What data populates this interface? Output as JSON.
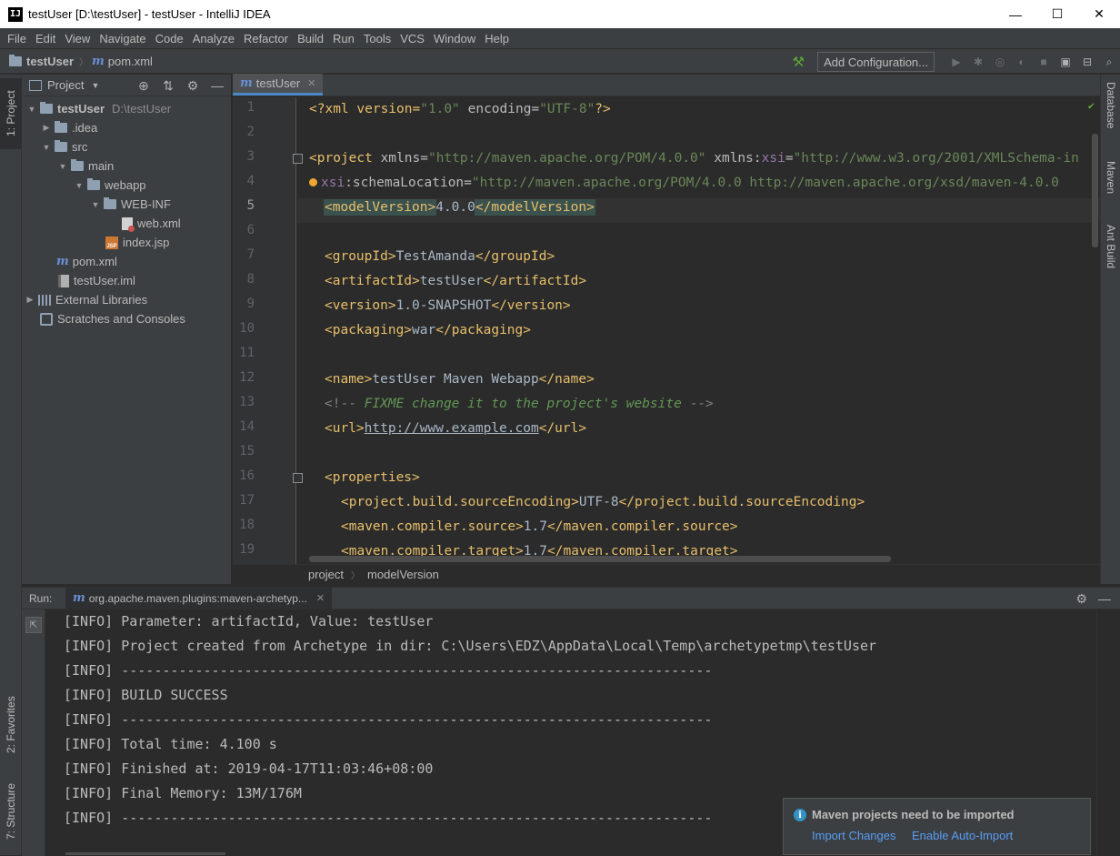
{
  "window": {
    "title": "testUser [D:\\testUser] - testUser - IntelliJ IDEA",
    "app_icon": "IJ",
    "minimize": "—",
    "maximize": "☐",
    "close": "✕"
  },
  "menu": [
    "File",
    "Edit",
    "View",
    "Navigate",
    "Code",
    "Analyze",
    "Refactor",
    "Build",
    "Run",
    "Tools",
    "VCS",
    "Window",
    "Help"
  ],
  "nav": {
    "project": "testUser",
    "file": "pom.xml",
    "add_config": "Add Configuration..."
  },
  "left_tabs": {
    "project": "1: Project",
    "favorites": "2: Favorites",
    "structure": "7: Structure"
  },
  "right_tabs": {
    "database": "Database",
    "maven": "Maven",
    "ant": "Ant Build"
  },
  "project_panel": {
    "title": "Project",
    "tree": [
      {
        "label": "testUser",
        "sub": "D:\\testUser"
      },
      {
        "label": ".idea"
      },
      {
        "label": "src"
      },
      {
        "label": "main"
      },
      {
        "label": "webapp"
      },
      {
        "label": "WEB-INF"
      },
      {
        "label": "web.xml"
      },
      {
        "label": "index.jsp"
      },
      {
        "label": "pom.xml"
      },
      {
        "label": "testUser.iml"
      },
      {
        "label": "External Libraries"
      },
      {
        "label": "Scratches and Consoles"
      }
    ]
  },
  "editor": {
    "tab": "testUser",
    "line_numbers": [
      "1",
      "2",
      "3",
      "4",
      "5",
      "6",
      "7",
      "8",
      "9",
      "10",
      "11",
      "12",
      "13",
      "14",
      "15",
      "16",
      "17",
      "18",
      "19"
    ],
    "breadcrumb": [
      "project",
      "modelVersion"
    ]
  },
  "code": {
    "l1": [
      "<?xml version=",
      "\"1.0\"",
      " encoding=",
      "\"UTF-8\"",
      "?>"
    ],
    "l3": [
      "<project ",
      "xmlns",
      "=",
      "\"http://maven.apache.org/POM/4.0.0\"",
      " xmlns:",
      "xsi",
      "=",
      "\"http://www.w3.org/2001/XMLSchema-in"
    ],
    "l4": [
      "xsi",
      ":schemaLocation",
      "=",
      "\"http://maven.apache.org/POM/4.0.0 http://maven.apache.org/xsd/maven-4.0.0"
    ],
    "l5": [
      "<modelVersion>",
      "4.0.0",
      "</modelVersion>"
    ],
    "l7": [
      "<groupId>",
      "TestAmanda",
      "</groupId>"
    ],
    "l8": [
      "<artifactId>",
      "testUser",
      "</artifactId>"
    ],
    "l9": [
      "<version>",
      "1.0-SNAPSHOT",
      "</version>"
    ],
    "l10": [
      "<packaging>",
      "war",
      "</packaging>"
    ],
    "l12": [
      "<name>",
      "testUser Maven Webapp",
      "</name>"
    ],
    "l13": [
      "<!--",
      " FIXME change it to the project's website ",
      "-->"
    ],
    "l14": [
      "<url>",
      "http://www.example.com",
      "</url>"
    ],
    "l16": [
      "<properties>"
    ],
    "l17": [
      "<project.build.sourceEncoding>",
      "UTF-8",
      "</project.build.sourceEncoding>"
    ],
    "l18": [
      "<maven.compiler.source>",
      "1.7",
      "</maven.compiler.source>"
    ],
    "l19": [
      "<maven.compiler.target>",
      "1.7",
      "</maven.compiler.target>"
    ]
  },
  "run": {
    "label": "Run:",
    "tab": "org.apache.maven.plugins:maven-archetyp...",
    "lines": [
      "[INFO] Parameter: artifactId, Value: testUser",
      "[INFO] Project created from Archetype in dir: C:\\Users\\EDZ\\AppData\\Local\\Temp\\archetypetmp\\testUser",
      "[INFO] ------------------------------------------------------------------------",
      "[INFO] BUILD SUCCESS",
      "[INFO] ------------------------------------------------------------------------",
      "[INFO] Total time: 4.100 s",
      "[INFO] Finished at: 2019-04-17T11:03:46+08:00",
      "[INFO] Final Memory: 13M/176M",
      "[INFO] ------------------------------------------------------------------------"
    ]
  },
  "notification": {
    "title": "Maven projects need to be imported",
    "action1": "Import Changes",
    "action2": "Enable Auto-Import"
  },
  "icons": {
    "gear": "⚙",
    "minus": "—",
    "target": "⊕",
    "collapse": "⇅",
    "play": "▶",
    "check": "✔",
    "info": "i"
  },
  "colors": {
    "tag": "#e8bf6a",
    "attr_value": "#6a8759",
    "namespace": "#9876aa",
    "comment": "#629755",
    "link": "#589df6",
    "accent": "#4a88c7"
  }
}
